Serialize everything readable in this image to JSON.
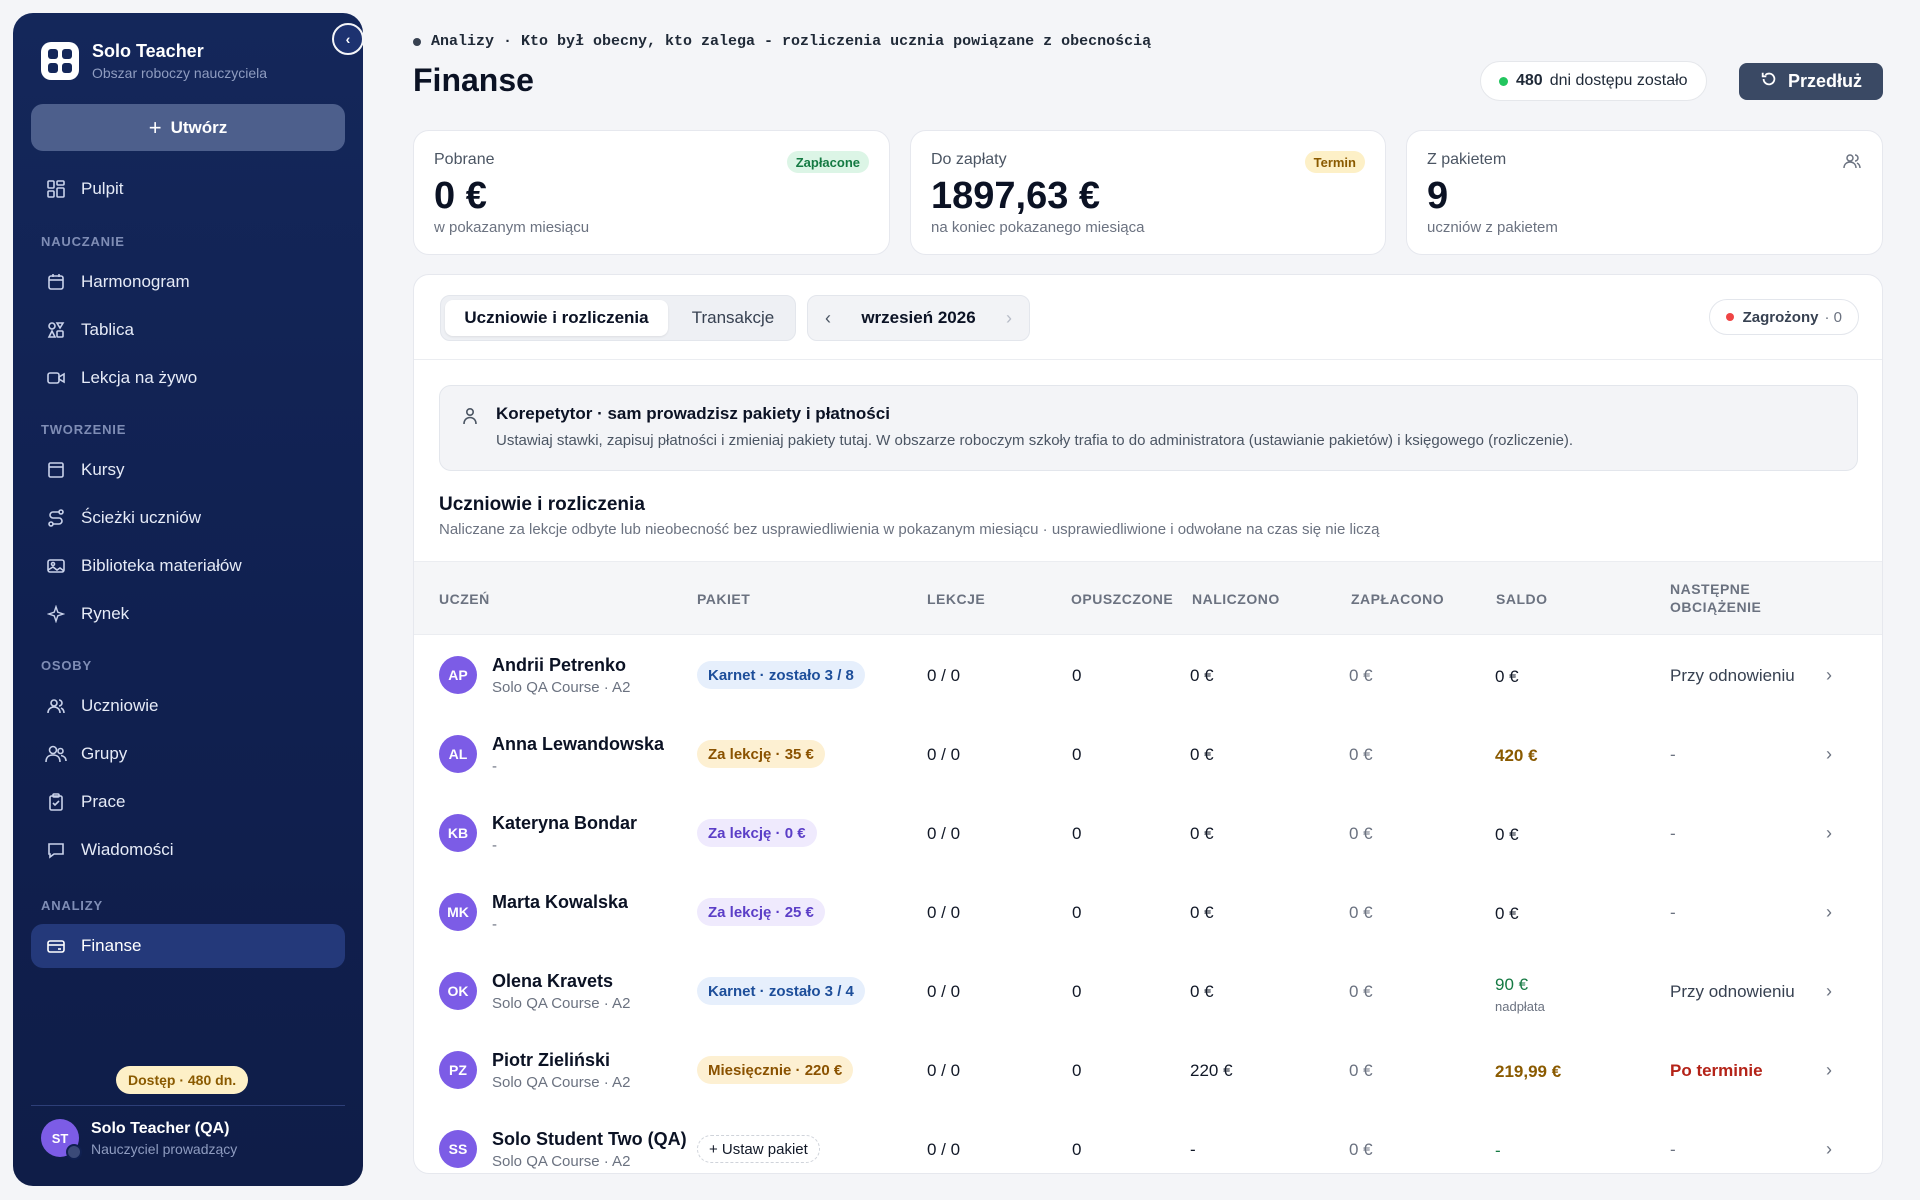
{
  "sidebar": {
    "brand_title": "Solo Teacher",
    "brand_subtitle": "Obszar roboczy nauczyciela",
    "create_label": "Utwórz",
    "dashboard_label": "Pulpit",
    "sections": {
      "teaching": "NAUCZANIE",
      "creating": "TWORZENIE",
      "people": "OSOBY",
      "analytics": "ANALIZY"
    },
    "items": {
      "schedule": "Harmonogram",
      "board": "Tablica",
      "live": "Lekcja na żywo",
      "courses": "Kursy",
      "paths": "Ścieżki uczniów",
      "library": "Biblioteka materiałów",
      "market": "Rynek",
      "students": "Uczniowie",
      "groups": "Grupy",
      "works": "Prace",
      "messages": "Wiadomości",
      "finance": "Finanse"
    },
    "access_badge": "Dostęp · 480 dn.",
    "user": {
      "initials": "ST",
      "name": "Solo Teacher (QA)",
      "role": "Nauczyciel prowadzący"
    }
  },
  "header": {
    "breadcrumb": "Analizy · Kto był obecny, kto zalega - rozliczenia ucznia powiązane z obecnością",
    "title": "Finanse",
    "days_count": "480",
    "days_label": "dni dostępu zostało",
    "extend_label": "Przedłuż"
  },
  "stats": [
    {
      "label": "Pobrane",
      "value": "0 €",
      "sub": "w pokazanym miesiącu",
      "tag": "Zapłacone"
    },
    {
      "label": "Do zapłaty",
      "value": "1897,63 €",
      "sub": "na koniec pokazanego miesiąca",
      "tag": "Termin"
    },
    {
      "label": "Z pakietem",
      "value": "9",
      "sub": "uczniów z pakietem",
      "icon": "users-icon"
    }
  ],
  "tabs": {
    "students_billing": "Uczniowie i rozliczenia",
    "transactions": "Transakcje",
    "month": "wrzesień 2026",
    "risk_label": "Zagrożony",
    "risk_count": "· 0"
  },
  "info": {
    "title": "Korepetytor · sam prowadzisz pakiety i płatności",
    "text": "Ustawiaj stawki, zapisuj płatności i zmieniaj pakiety tutaj. W obszarze roboczym szkoły trafia to do administratora (ustawianie pakietów) i księgowego (rozliczenie)."
  },
  "section": {
    "title": "Uczniowie i rozliczenia",
    "subtitle": "Naliczane za lekcje odbyte lub nieobecność bez usprawiedliwienia w pokazanym miesiącu · usprawiedliwione i odwołane na czas się nie liczą"
  },
  "table": {
    "headers": {
      "student": "UCZEŃ",
      "package": "PAKIET",
      "lessons": "LEKCJE",
      "missed": "OPUSZCZONE",
      "charged": "NALICZONO",
      "paid": "ZAPŁACONO",
      "balance": "SALDO",
      "next_line1": "NASTĘPNE",
      "next_line2": "OBCIĄŻENIE"
    },
    "rows": [
      {
        "initials": "AP",
        "name": "Andrii Petrenko",
        "course": "Solo QA Course · A2",
        "package": "Karnet · zostało 3 / 8",
        "pkg_style": "blue",
        "lessons": "0 / 0",
        "missed": "0",
        "charged": "0 €",
        "paid": "0 €",
        "balance": "0 €",
        "balance_note": "",
        "balance_style": "",
        "next": "Przy odnowieniu",
        "next_style": ""
      },
      {
        "initials": "AL",
        "name": "Anna Lewandowska",
        "course": "-",
        "package": "Za lekcję · 35 €",
        "pkg_style": "amber",
        "lessons": "0 / 0",
        "missed": "0",
        "charged": "0 €",
        "paid": "0 €",
        "balance": "420 €",
        "balance_note": "",
        "balance_style": "amber",
        "next": "-",
        "next_style": "muted"
      },
      {
        "initials": "KB",
        "name": "Kateryna Bondar",
        "course": "-",
        "package": "Za lekcję · 0 €",
        "pkg_style": "violet",
        "lessons": "0 / 0",
        "missed": "0",
        "charged": "0 €",
        "paid": "0 €",
        "balance": "0 €",
        "balance_note": "",
        "balance_style": "",
        "next": "-",
        "next_style": "muted"
      },
      {
        "initials": "MK",
        "name": "Marta Kowalska",
        "course": "-",
        "package": "Za lekcję · 25 €",
        "pkg_style": "violet",
        "lessons": "0 / 0",
        "missed": "0",
        "charged": "0 €",
        "paid": "0 €",
        "balance": "0 €",
        "balance_note": "",
        "balance_style": "",
        "next": "-",
        "next_style": "muted"
      },
      {
        "initials": "OK",
        "name": "Olena Kravets",
        "course": "Solo QA Course · A2",
        "package": "Karnet · zostało 3 / 4",
        "pkg_style": "blue",
        "lessons": "0 / 0",
        "missed": "0",
        "charged": "0 €",
        "paid": "0 €",
        "balance": "90 €",
        "balance_note": "nadpłata",
        "balance_style": "green",
        "next": "Przy odnowieniu",
        "next_style": ""
      },
      {
        "initials": "PZ",
        "name": "Piotr Zieliński",
        "course": "Solo QA Course · A2",
        "package": "Miesięcznie · 220 €",
        "pkg_style": "amber",
        "lessons": "0 / 0",
        "missed": "0",
        "charged": "220 €",
        "paid": "0 €",
        "balance": "219,99 €",
        "balance_note": "",
        "balance_style": "amber",
        "next": "Po terminie",
        "next_style": "red"
      },
      {
        "initials": "SS",
        "name": "Solo Student Two (QA)",
        "course": "Solo QA Course · A2",
        "package": "+ Ustaw pakiet",
        "pkg_style": "outline",
        "lessons": "0 / 0",
        "missed": "0",
        "charged": "-",
        "paid": "0 €",
        "balance": "-",
        "balance_note": "",
        "balance_style": "green",
        "next": "-",
        "next_style": "muted"
      }
    ]
  },
  "colors": {
    "sidebar_bg": "#14275a",
    "accent_avatar": "#7c5ce6",
    "extend_button": "#3a4964"
  }
}
